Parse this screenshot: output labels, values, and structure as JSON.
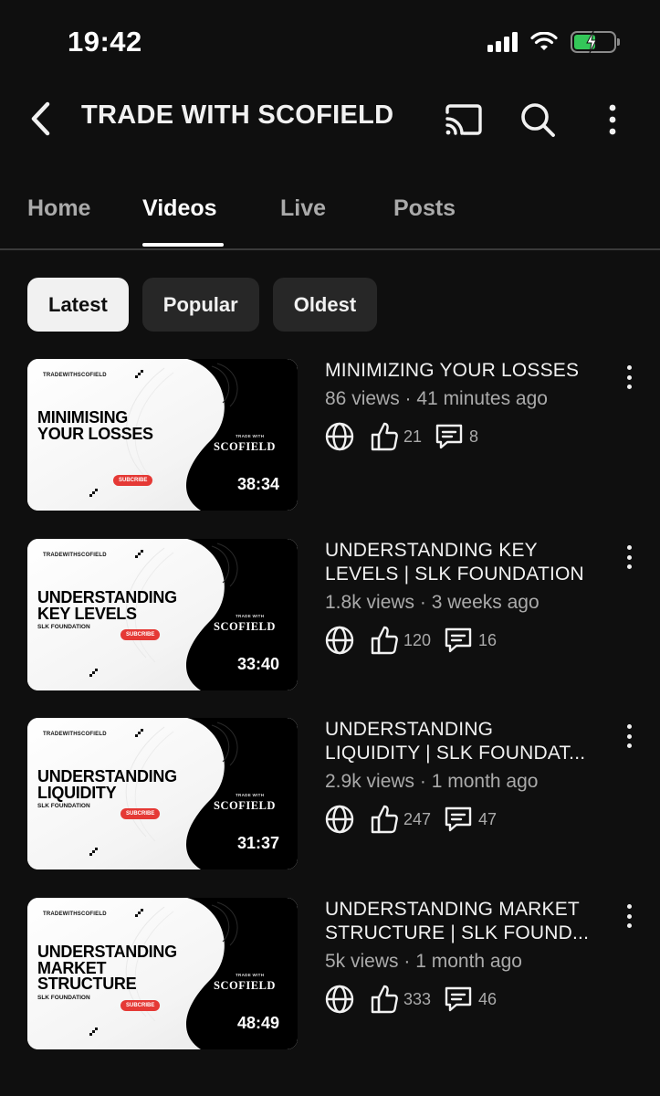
{
  "status_bar": {
    "time": "19:42"
  },
  "header": {
    "channel_title": "TRADE WITH SCOFIELD"
  },
  "tabs": [
    {
      "label": "Home",
      "active": false
    },
    {
      "label": "Videos",
      "active": true
    },
    {
      "label": "Live",
      "active": false
    },
    {
      "label": "Posts",
      "active": false
    }
  ],
  "chips": [
    {
      "label": "Latest",
      "selected": true
    },
    {
      "label": "Popular",
      "selected": false
    },
    {
      "label": "Oldest",
      "selected": false
    }
  ],
  "thumbnail_common": {
    "brand": "TRADEWITHSCOFIELD",
    "subscribe": "SUBCRIBE",
    "trade_with": "TRADE WITH",
    "scofield": "SCOFIELD",
    "foundation": "SLK FOUNDATION"
  },
  "videos": [
    {
      "title_line1": "MINIMIZING YOUR LOSSES",
      "title_line2": "",
      "views": "86 views",
      "age": "41 minutes ago",
      "likes": "21",
      "comments": "8",
      "duration": "38:34",
      "thumb_title_lines": [
        "MINIMISING",
        "YOUR LOSSES"
      ],
      "thumb_has_foundation": false
    },
    {
      "title_line1": "UNDERSTANDING KEY",
      "title_line2": "LEVELS | SLK FOUNDATION",
      "views": "1.8k views",
      "age": "3 weeks ago",
      "likes": "120",
      "comments": "16",
      "duration": "33:40",
      "thumb_title_lines": [
        "UNDERSTANDING",
        "KEY LEVELS"
      ],
      "thumb_has_foundation": true
    },
    {
      "title_line1": "UNDERSTANDING",
      "title_line2": "LIQUIDITY | SLK FOUNDAT...",
      "views": "2.9k views",
      "age": "1 month ago",
      "likes": "247",
      "comments": "47",
      "duration": "31:37",
      "thumb_title_lines": [
        "UNDERSTANDING",
        "LIQUIDITY"
      ],
      "thumb_has_foundation": true
    },
    {
      "title_line1": "UNDERSTANDING MARKET",
      "title_line2": "STRUCTURE | SLK FOUND...",
      "views": "5k views",
      "age": "1 month ago",
      "likes": "333",
      "comments": "46",
      "duration": "48:49",
      "thumb_title_lines": [
        "UNDERSTANDING",
        "MARKET",
        "STRUCTURE"
      ],
      "thumb_has_foundation": true
    }
  ],
  "colors": {
    "background": "#0f0f0f",
    "text_primary": "#f1f1f1",
    "text_secondary": "#aaaaaa",
    "chip_bg": "#272727",
    "battery_green": "#34c759",
    "subscribe_red": "#e53935"
  },
  "icons": [
    "back-arrow-icon",
    "cast-icon",
    "search-icon",
    "more-vertical-icon",
    "globe-icon",
    "thumbs-up-icon",
    "comment-icon"
  ]
}
